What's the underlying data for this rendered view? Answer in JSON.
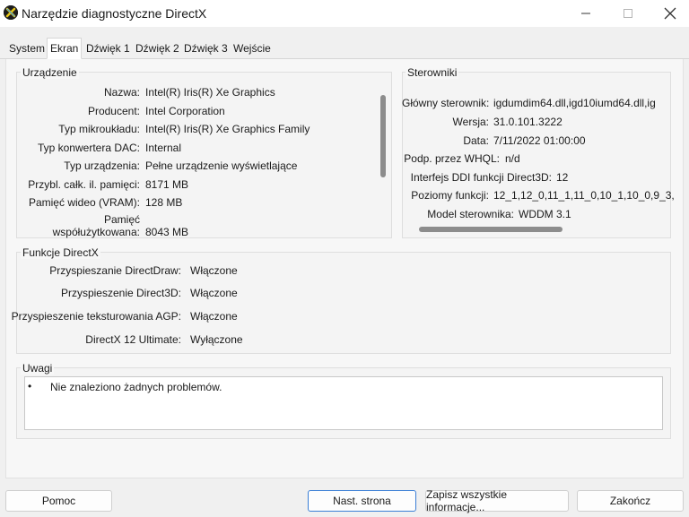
{
  "window": {
    "title": "Narzędzie diagnostyczne DirectX"
  },
  "tabs": [
    {
      "label": "System"
    },
    {
      "label": "Ekran"
    },
    {
      "label": "Dźwięk 1"
    },
    {
      "label": "Dźwięk 2"
    },
    {
      "label": "Dźwięk 3"
    },
    {
      "label": "Wejście"
    }
  ],
  "active_tab": "Ekran",
  "device": {
    "title": "Urządzenie",
    "rows": [
      {
        "key": "Nazwa:",
        "value": "Intel(R) Iris(R) Xe Graphics"
      },
      {
        "key": "Producent:",
        "value": "Intel Corporation"
      },
      {
        "key": "Typ mikroukładu:",
        "value": "Intel(R) Iris(R) Xe Graphics Family"
      },
      {
        "key": "Typ konwertera DAC:",
        "value": "Internal"
      },
      {
        "key": "Typ urządzenia:",
        "value": "Pełne urządzenie wyświetlające"
      },
      {
        "key": "Przybl. całk. il. pamięci:",
        "value": "8171 MB"
      },
      {
        "key": "Pamięć wideo (VRAM):",
        "value": "128 MB"
      },
      {
        "key": "Pamięć współużytkowana:",
        "key_line1": "Pamięć",
        "key_line2": "współużytkowana:",
        "value": "8043 MB"
      }
    ]
  },
  "drivers": {
    "title": "Sterowniki",
    "rows": [
      {
        "key": "Główny sterownik:",
        "value": "igdumdim64.dll,igd10iumd64.dll,ig"
      },
      {
        "key": "Wersja:",
        "value": "31.0.101.3222"
      },
      {
        "key": "Data:",
        "value": "7/11/2022 01:00:00"
      },
      {
        "key": "Podp. przez WHQL:",
        "value": "n/d"
      },
      {
        "key": "Interfejs DDI funkcji Direct3D:",
        "value": "12"
      },
      {
        "key": "Poziomy funkcji:",
        "value": "12_1,12_0,11_1,11_0,10_1,10_0,9_3,"
      },
      {
        "key": "Model sterownika:",
        "value": "WDDM 3.1"
      }
    ]
  },
  "directx": {
    "title": "Funkcje DirectX",
    "rows": [
      {
        "key": "Przyspieszanie DirectDraw:",
        "value": "Włączone"
      },
      {
        "key": "Przyspieszenie Direct3D:",
        "value": "Włączone"
      },
      {
        "key": "Przyspieszenie teksturowania AGP:",
        "value": "Włączone"
      },
      {
        "key": "DirectX 12 Ultimate:",
        "value": "Wyłączone"
      }
    ]
  },
  "notes": {
    "title": "Uwagi",
    "bullet": "•",
    "items": [
      "Nie znaleziono żadnych problemów."
    ]
  },
  "footer": {
    "help": "Pomoc",
    "next": "Nast. strona",
    "save_all": "Zapisz wszystkie informacje...",
    "exit": "Zakończ"
  },
  "colors": {
    "accent": "#3b7fd6"
  }
}
